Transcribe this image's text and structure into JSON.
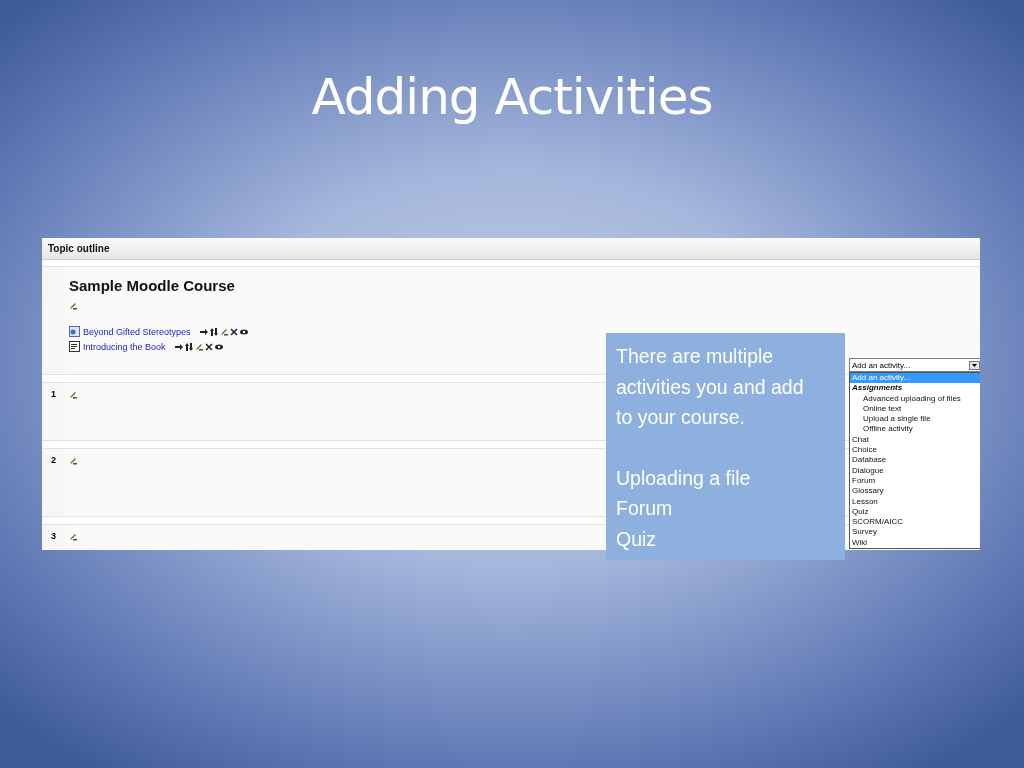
{
  "slide": {
    "title": "Adding Activities"
  },
  "course_page": {
    "header": "Topic outline",
    "course_title": "Sample Moodle Course",
    "resources": [
      {
        "kind": "link",
        "title": "Beyond Gifted Stereotypes"
      },
      {
        "kind": "document",
        "title": "Introducing the Book"
      }
    ],
    "sections": [
      {
        "number": "1"
      },
      {
        "number": "2"
      },
      {
        "number": "3"
      }
    ],
    "activity_menu": {
      "value": "Add an activity...",
      "options": [
        {
          "kind": "option",
          "label": "Add an activity...",
          "selected": true
        },
        {
          "kind": "group",
          "label": "Assignments",
          "selected": false,
          "children": [
            {
              "kind": "option",
              "label": "Advanced uploading of files",
              "selected": false
            },
            {
              "kind": "option",
              "label": "Online text",
              "selected": false
            },
            {
              "kind": "option",
              "label": "Upload a single file",
              "selected": false
            },
            {
              "kind": "option",
              "label": "Offline activity",
              "selected": false
            }
          ]
        },
        {
          "kind": "option",
          "label": "Chat",
          "selected": false
        },
        {
          "kind": "option",
          "label": "Choice",
          "selected": false
        },
        {
          "kind": "option",
          "label": "Database",
          "selected": false
        },
        {
          "kind": "option",
          "label": "Dialogue",
          "selected": false
        },
        {
          "kind": "option",
          "label": "Forum",
          "selected": false
        },
        {
          "kind": "option",
          "label": "Glossary",
          "selected": false
        },
        {
          "kind": "option",
          "label": "Lesson",
          "selected": false
        },
        {
          "kind": "option",
          "label": "Quiz",
          "selected": false
        },
        {
          "kind": "option",
          "label": "SCORM/AICC",
          "selected": false
        },
        {
          "kind": "option",
          "label": "Survey",
          "selected": false
        },
        {
          "kind": "option",
          "label": "Wiki",
          "selected": false
        }
      ]
    }
  },
  "callout": {
    "text": "There are multiple activities you and add to your course.",
    "items": [
      "Uploading a file",
      "Forum",
      "Quiz"
    ]
  }
}
